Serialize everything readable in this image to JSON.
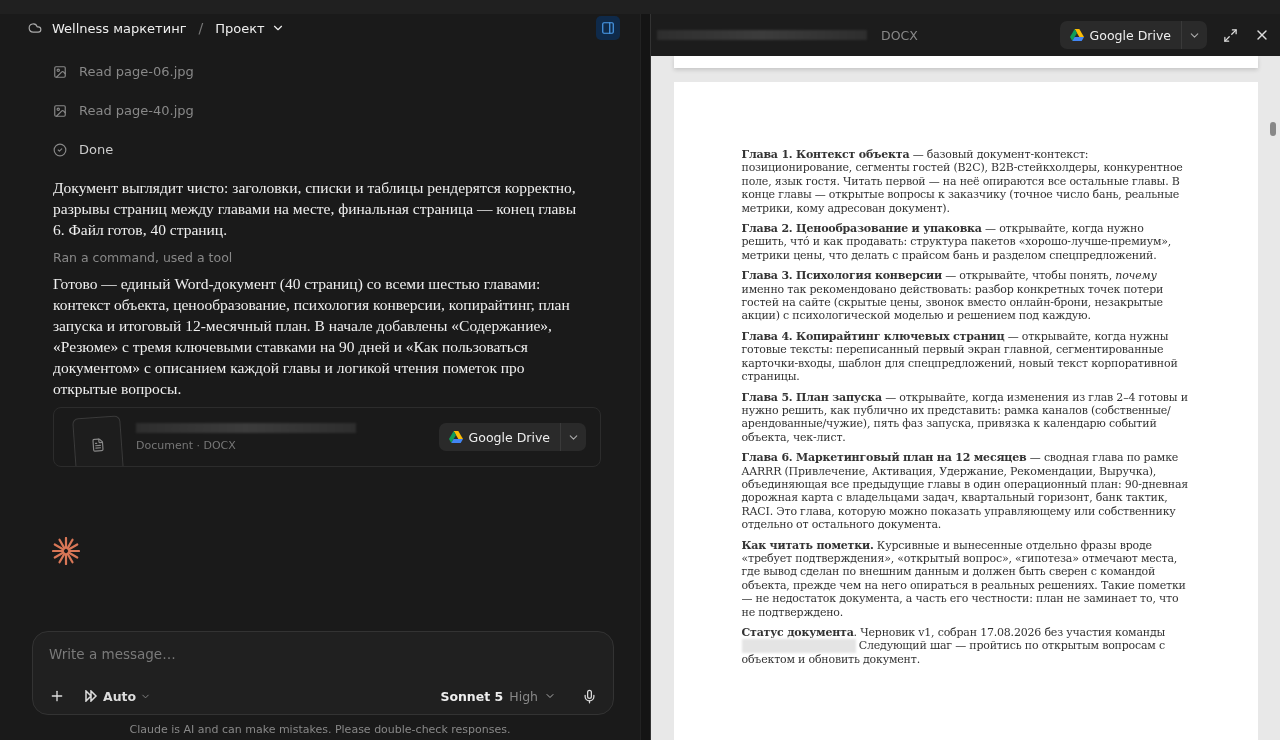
{
  "breadcrumb": {
    "project": "Wellness маркетинг",
    "separator": "/",
    "folder": "Проект"
  },
  "steps": [
    {
      "kind": "image",
      "label": "Read page-06.jpg"
    },
    {
      "kind": "image",
      "label": "Read page-40.jpg"
    },
    {
      "kind": "done",
      "label": "Done"
    }
  ],
  "message_1": "Документ выглядит чисто: заголовки, списки и таблицы рендерятся корректно, разрывы страниц между главами на месте, финальная страница — конец главы 6. Файл готов, 40 страниц.",
  "tool_summary": "Ran a command, used a tool",
  "message_2": "Готово — единый Word-документ (40 страниц) со всеми шестью главами: контекст объекта, ценообразование, психология конверсии, копирайтинг, план запуска и итоговый 12-месячный план. В начале добавлены «Содержание», «Резюме» с тремя ключевыми ставками на 90 дней и «Как пользоваться документом» с описанием каждой главы и логикой чтения пометок про открытые вопросы.",
  "file_card": {
    "meta": "Document · DOCX",
    "button": "Google Drive"
  },
  "composer": {
    "placeholder": "Write a message…",
    "mode": "Auto",
    "model": "Sonnet 5",
    "effort": "High"
  },
  "disclaimer": "Claude is AI and can make mistakes. Please double-check responses.",
  "preview": {
    "type": "DOCX",
    "button": "Google Drive",
    "paragraphs": [
      "**Глава 1. Контекст объекта** — базовый документ-контекст: позиционирование, сегменты гостей (B2C), B2B-стейкхолдеры, конкурентное поле, язык гостя. Читать первой — на неё опираются все остальные главы. В конце главы — открытые вопросы к заказчику (точное число бань, реальные метрики, кому адресован документ).",
      "**Глава 2. Ценообразование и упаковка** — открывайте, когда нужно решить, чтó и как продавать: структура пакетов «хорошо-лучше-премиум», метрики цены, что делать с прайсом бань и разделом спецпредложений.",
      "**Глава 3. Психология конверсии** — открывайте, чтобы понять, *почему* именно так рекомендовано действовать: разбор конкретных точек потери гостей на сайте (скрытые цены, звонок вместо онлайн-брони, незакрытые акции) с психологической моделью и решением под каждую.",
      "**Глава 4. Копирайтинг ключевых страниц** — открывайте, когда нужны готовые тексты: переписанный первый экран главной, сегментированные карточки-входы, шаблон для спецпредложений, новый текст корпоративной страницы.",
      "**Глава 5. План запуска** — открывайте, когда изменения из глав 2–4 готовы и нужно решить, как публично их представить: рамка каналов (собственные/арендованные/чужие), пять фаз запуска, привязка к календарю событий объекта, чек-лист.",
      "**Глава 6. Маркетинговый план на 12 месяцев** — сводная глава по рамке AARRR (Привлечение, Активация, Удержание, Рекомендации, Выручка), объединяющая все предыдущие главы в один операционный план: 90-дневная дорожная карта с владельцами задач, квартальный горизонт, банк тактик, RACI. Это глава, которую можно показать управляющему или собственнику отдельно от остального документа.",
      "**Как читать пометки.** Курсивные и вынесенные отдельно фразы вроде «требует подтверждения», «открытый вопрос», «гипотеза» отмечают места, где вывод сделан по внешним данным и должен быть сверен с командой объекта, прежде чем на него опираться в реальных решениях. Такие пометки — не недостаток документа, а часть его честности: план не заминает то, что не подтверждено."
    ],
    "status": {
      "before": "**Статус документа**. Черновик v1, собран 17.08.2026 без участия команды",
      "after": "Следующий шаг — пройтись по открытым вопросам с объектом и обновить документ."
    }
  }
}
